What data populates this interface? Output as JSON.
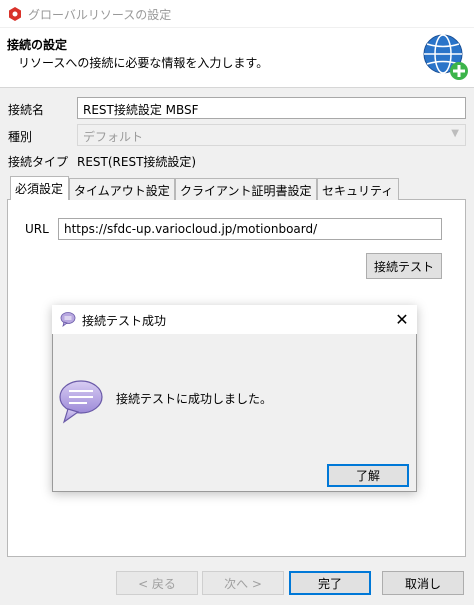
{
  "window": {
    "title": "グローバルリソースの設定"
  },
  "header": {
    "title": "接続の設定",
    "description": "リソースへの接続に必要な情報を入力します。",
    "icon": "globe-add-icon"
  },
  "form": {
    "connection_name_label": "接続名",
    "connection_name_value": "REST接続設定 MBSF",
    "type_label": "種別",
    "type_value": "デフォルト",
    "connection_type_label": "接続タイプ",
    "connection_type_value": "REST(REST接続設定)"
  },
  "tabs": [
    {
      "label": "必須設定",
      "active": true
    },
    {
      "label": "タイムアウト設定",
      "active": false
    },
    {
      "label": "クライアント証明書設定",
      "active": false
    },
    {
      "label": "セキュリティ",
      "active": false
    }
  ],
  "required": {
    "url_label": "URL",
    "url_value": "https://sfdc-up.variocloud.jp/motionboard/",
    "test_button": "接続テスト"
  },
  "dialog": {
    "title": "接続テスト成功",
    "message": "接続テストに成功しました。",
    "ok_button": "了解",
    "close_symbol": "✕"
  },
  "footer": {
    "back_button": "< 戻る",
    "next_button": "次へ >",
    "finish_button": "完了",
    "cancel_button": "取消し"
  },
  "colors": {
    "accent": "#0078d7",
    "app_icon": "#d9322a",
    "globe": "#2a74c9",
    "plus": "#3cb44a"
  }
}
